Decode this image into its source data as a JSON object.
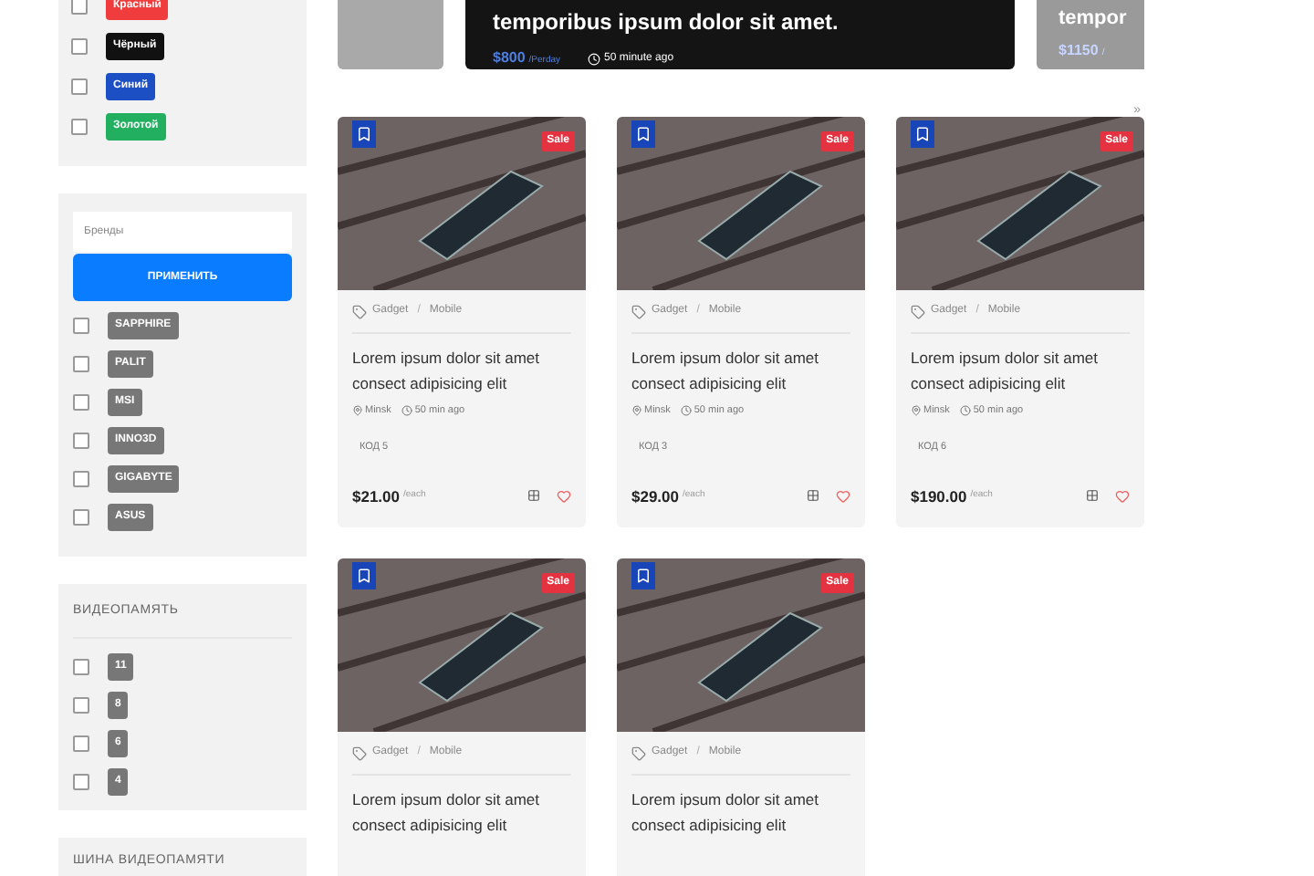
{
  "sidebar": {
    "color_filter": {
      "items": [
        {
          "label": "Красный",
          "color": "#f03c3c",
          "checked": false
        },
        {
          "label": "Чёрный",
          "color": "#111111",
          "checked": false
        },
        {
          "label": "Синий",
          "color": "#1d4fc4",
          "checked": false
        },
        {
          "label": "Золотой",
          "color": "#22b060",
          "checked": false
        }
      ]
    },
    "brand_filter": {
      "search": {
        "placeholder": "Бренды"
      },
      "apply_button": "ПРИМЕНИТЬ",
      "items": [
        {
          "label": "SAPPHIRE",
          "checked": false
        },
        {
          "label": "PALIT",
          "checked": false
        },
        {
          "label": "MSI",
          "checked": false
        },
        {
          "label": "INNO3D",
          "checked": false
        },
        {
          "label": "GIGABYTE",
          "checked": false
        },
        {
          "label": "ASUS",
          "checked": false
        }
      ]
    },
    "memory_filter": {
      "title": "ВИДЕОПАМЯТЬ",
      "items": [
        {
          "label": "11",
          "checked": false
        },
        {
          "label": "8",
          "checked": false
        },
        {
          "label": "6",
          "checked": false
        },
        {
          "label": "4",
          "checked": false
        }
      ]
    },
    "bus_filter": {
      "title": "ШИНА ВИДЕОПАМЯТИ"
    }
  },
  "banners": [
    {
      "title": "temporibus ipsum dolor sit amet.",
      "price": "$800",
      "unit": "/Perday",
      "time": "50 minute ago"
    },
    {
      "title": "tempor",
      "price": "$1150",
      "unit": "/"
    }
  ],
  "pager": "»",
  "products": [
    {
      "badge": "Sale",
      "category": "Gadget",
      "separator": "/",
      "subcategory": "Mobile",
      "title": "Lorem ipsum dolor sit amet consect adipisicing elit",
      "location": "Minsk",
      "time": "50 min ago",
      "code": "КОД 5",
      "price": "$21.00",
      "unit": "/each"
    },
    {
      "badge": "Sale",
      "category": "Gadget",
      "separator": "/",
      "subcategory": "Mobile",
      "title": "Lorem ipsum dolor sit amet consect adipisicing elit",
      "location": "Minsk",
      "time": "50 min ago",
      "code": "КОД 3",
      "price": "$29.00",
      "unit": "/each"
    },
    {
      "badge": "Sale",
      "category": "Gadget",
      "separator": "/",
      "subcategory": "Mobile",
      "title": "Lorem ipsum dolor sit amet consect adipisicing elit",
      "location": "Minsk",
      "time": "50 min ago",
      "code": "КОД 6",
      "price": "$190.00",
      "unit": "/each"
    },
    {
      "badge": "Sale",
      "category": "Gadget",
      "separator": "/",
      "subcategory": "Mobile",
      "title": "Lorem ipsum dolor sit amet consect adipisicing elit"
    },
    {
      "badge": "Sale",
      "category": "Gadget",
      "separator": "/",
      "subcategory": "Mobile",
      "title": "Lorem ipsum dolor sit amet consect adipisicing elit"
    }
  ]
}
